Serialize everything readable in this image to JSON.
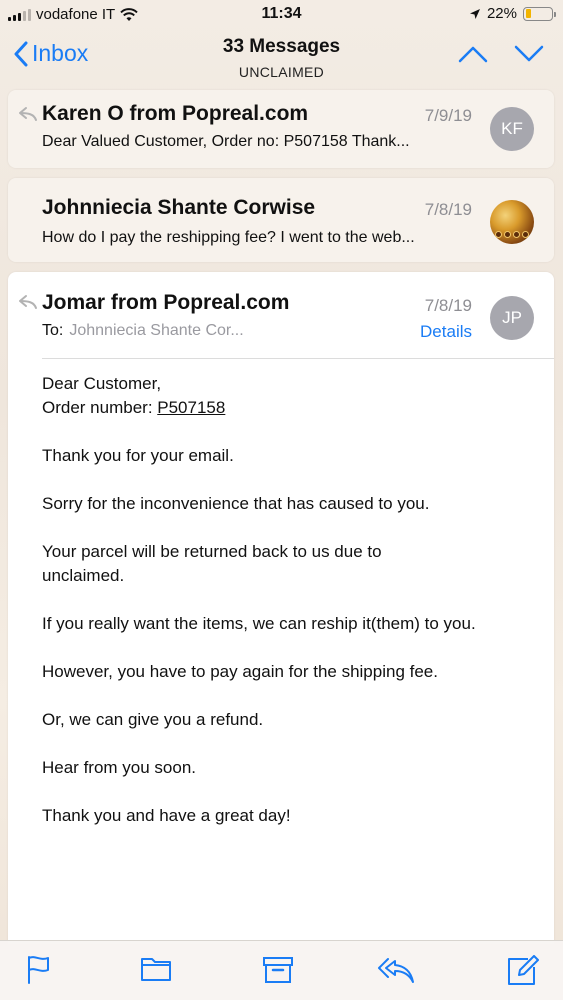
{
  "status_bar": {
    "carrier": "vodafone IT",
    "time": "11:34",
    "battery": "22%",
    "battery_level": 0.22
  },
  "nav": {
    "back_label": "Inbox",
    "title": "33 Messages",
    "subtitle": "UNCLAIMED"
  },
  "messages": [
    {
      "sender": "Karen O from Popreal.com",
      "date": "7/9/19",
      "preview": "Dear Valued Customer, Order no: P507158 Thank...",
      "avatar_initials": "KF"
    },
    {
      "sender": "Johnniecia Shante Corwise",
      "date": "7/8/19",
      "preview": "How do I pay the reshipping fee? I went to the web..."
    }
  ],
  "open_message": {
    "sender": "Jomar from Popreal.com",
    "date": "7/8/19",
    "to_label": "To:",
    "to_value": "Johnniecia Shante Cor...",
    "details_label": "Details",
    "avatar_initials": "JP",
    "greeting": "Dear Customer,",
    "order_label": "Order number: ",
    "order_number": "P507158",
    "paragraphs": [
      "Thank you for your email.",
      "Sorry for the inconvenience that has caused to you.",
      "Your parcel will be returned back to us due to unclaimed.",
      "If you really want the items, we can reship it(them) to you.",
      "However, you have to pay again for the shipping fee.",
      "Or, we can give you a refund.",
      "Hear from you soon.",
      "Thank you and have a great day!"
    ]
  },
  "toolbar": {
    "icons": [
      "flag-icon",
      "folder-icon",
      "archive-icon",
      "reply-icon",
      "compose-icon"
    ]
  },
  "colors": {
    "accent": "#1a7cf5",
    "avatar_gray": "#a7a7ae",
    "battery_yellow": "#f2b400"
  }
}
